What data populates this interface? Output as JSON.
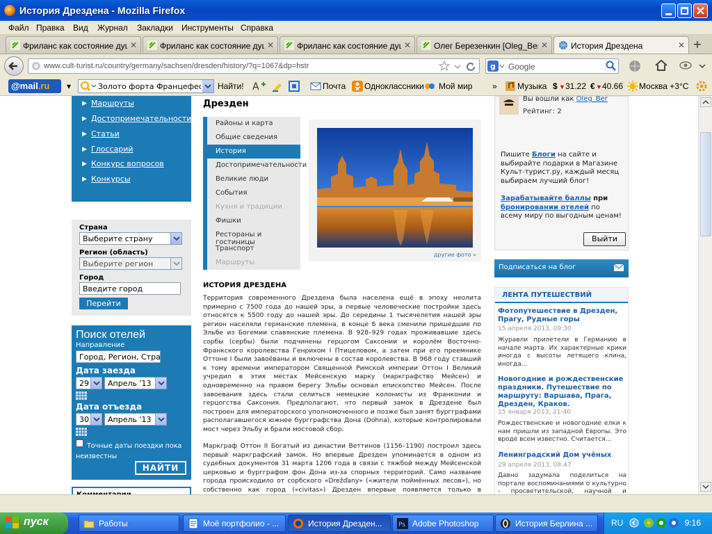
{
  "window": {
    "title": "История Дрездена - Mozilla Firefox"
  },
  "menu": [
    "Файл",
    "Правка",
    "Вид",
    "Журнал",
    "Закладки",
    "Инструменты",
    "Справка"
  ],
  "tabs": [
    {
      "label": "Фриланс как состояние душ...",
      "active": false
    },
    {
      "label": "Фриланс как состояние душ...",
      "active": false
    },
    {
      "label": "Фриланс как состояние душ...",
      "active": false
    },
    {
      "label": "Олег Березенкин [Oleg_Bere...",
      "active": false
    },
    {
      "label": "История Дрездена",
      "active": true
    }
  ],
  "nav": {
    "url": "www.cult-turist.ru/country/germany/sachsen/dresden/history/?q=1067&dp=hstr",
    "search_placeholder": "Google"
  },
  "mailbar": {
    "logo_main": "@mail",
    "logo_tld": ".ru",
    "search_value": "Золото форта Францефесте",
    "find": "Найти!",
    "mail": "Почта",
    "ok": "Одноклассники",
    "myworld": "Мой мир",
    "more": "»",
    "music": "Музыка",
    "usd": "31.22",
    "eur": "40.66",
    "weather": "Москва +3°C"
  },
  "left": {
    "nav": [
      "Маршруты",
      "Достопримечательности",
      "Статьи",
      "Глоссарий",
      "Конкурс вопросов",
      "Конкурсы"
    ],
    "country_label": "Страна",
    "country_value": "Выберите страну",
    "region_label": "Регион (область)",
    "region_value": "Выберите регион",
    "city_label": "Город",
    "city_value": "Введите город",
    "go": "Перейти",
    "hotel_title": "Поиск отелей",
    "direction_label": "Направление",
    "direction_value": "Город, Регион, Страна,",
    "checkin_label": "Дата заезда",
    "checkin_day": "29",
    "checkin_month": "Апрель '13",
    "checkout_label": "Дата отъезда",
    "checkout_day": "30",
    "checkout_month": "Апрель '13",
    "exact_dates": "Точные даты поездки пока неизвестны",
    "find_btn": "НАЙТИ",
    "comments": "Комментарии пользователей"
  },
  "center": {
    "heading": "Дрезден",
    "submenu": [
      {
        "label": "Районы и карта",
        "state": "normal"
      },
      {
        "label": "Общие сведения",
        "state": "normal"
      },
      {
        "label": "История",
        "state": "active"
      },
      {
        "label": "Достопримечательности",
        "state": "normal"
      },
      {
        "label": "Великие люди",
        "state": "normal"
      },
      {
        "label": "События",
        "state": "normal"
      },
      {
        "label": "Кухня и традиции",
        "state": "disabled"
      },
      {
        "label": "Фишки",
        "state": "normal"
      },
      {
        "label": "Рестораны и гостиницы",
        "state": "normal"
      },
      {
        "label": "Транспорт",
        "state": "normal"
      },
      {
        "label": "Маршруты",
        "state": "disabled"
      }
    ],
    "photo_more": "другие фото »",
    "article_title": "ИСТОРИЯ ДРЕЗДЕНА",
    "para1": "Территория современного Дрездена была населена ещё в эпоху неолита примерно с 7500 года до нашей эры, а первые человеческие постройки здесь относятся к 5500 году до нашей эры. До середины 1 тысячелетия нашей эры регион населяли германские племена, в конце 6 века сменили пришедшие по Эльбе из Богемии славянские племена. В 928–929 годах проживавшие здесь сорбы (сербы) были подчинены герцогом Саксонии и королём Восточно-Франкского королевства Генрихом I Птицеловом, а затем при его преемнике Оттоне I были завоёваны и включены в состав королевства. В 968 году ставший к тому времени императором Священной Римской империи Оттон I Великий учредил в этих местах Мейсенскую марку (маркграфство Мейсен) и одновременно на правом берегу Эльбы основал епископство Мейсен. После завоевания здесь стали селиться немецкие колонисты из Франконии и герцогства Саксония. Предполагают, что первый замок в Дрездене был построен для императорского уполномоченного и позже был занят бургграфами располагавшегося южнее бургграфства Дона (Dohna), которые контролировали мост через Эльбу и брали мостовой сбор.",
    "para2": "Маркграф Оттон II Богатый из династии Веттинов (1156–1190) построил здесь первый маркграфский замок. Но впервые Дрезден упоминается в одном из судебных документов 31 марта 1206 года в связи с тяжбой между Мейсенской церковью и бургграфом фон Дона из-за спорных территорий. Само название города происходило от сорбского «Drežďany» («жители поймённых лесов»), но собственно как город («civitas») Дрезден впервые появляется только в документе от 21 января 1216 года. В 1270 году Дрезден стал столицей маркграфства и"
  },
  "right": {
    "logged_in_prefix": "Вы вошли как",
    "username": "Oleg_Ber",
    "rating": "Рейтинг: 2",
    "blog_text_1": "Пишите",
    "blog_link": "Блоги",
    "blog_text_2": "на сайте и выбирайте подарки в Магазине Культ-турист.ру, каждый месяц выбираем лучший блог!",
    "earn_link": "Зарабатывайте баллы",
    "earn_mid": "при",
    "earn_link2": "бронировании отелей",
    "earn_tail": "по всему миру по выгодным ценам!",
    "exit": "Выйти",
    "subscribe": "Подписаться на блог",
    "feed_title": "ЛЕНТА ПУТЕШЕСТВИЙ",
    "feed": [
      {
        "title": "Фотопутешествие в Дрезден, Прагу, Рудные горы",
        "date": "15 апреля 2013, 09:30",
        "text": "Журавли прилетели в Германию в начале марта. Их характерные крики иногда с высоты летящего клина, иногда..."
      },
      {
        "title": "Новогодние и рождественские праздники. Путешествие по маршруту: Варшава, Прага, Дрезден, Краков.",
        "date": "15 января 2013, 21:40",
        "text": "Рождественские и новогодние елки к нам пришли из западной Европы. Это вроде всем известно. Считается..."
      },
      {
        "title": "Ленинградский Дом учёных",
        "date": "29 апреля 2013, 08:47",
        "text": "Давно задумала поделиться на портале воспоминаниями о культурно - просветительской, научной и туристской..."
      }
    ]
  },
  "taskbar": {
    "start": "пуск",
    "items": [
      {
        "label": "Работы",
        "active": false
      },
      {
        "label": "Моё портфолио - ...",
        "active": false
      },
      {
        "label": "История Дрезден...",
        "active": true
      },
      {
        "label": "Adobe Photoshop",
        "active": false
      },
      {
        "label": "История Берлина ...",
        "active": false
      }
    ],
    "lang": "RU",
    "time": "9:16"
  }
}
